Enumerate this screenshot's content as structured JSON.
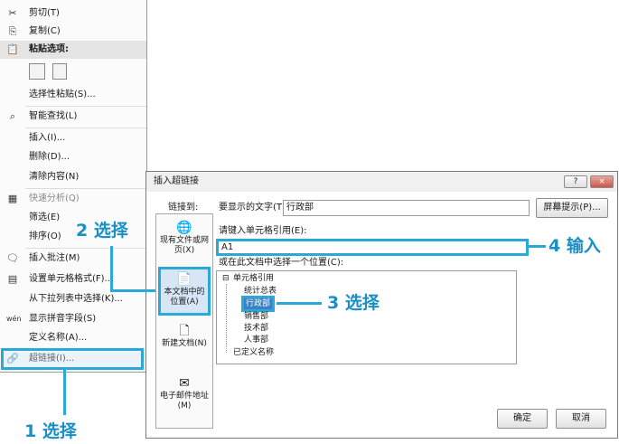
{
  "context_menu": {
    "cut": "剪切(T)",
    "copy": "复制(C)",
    "paste_options": "粘贴选项:",
    "paste_special": "选择性粘贴(S)...",
    "smart_lookup": "智能查找(L)",
    "insert": "插入(I)...",
    "delete": "删除(D)...",
    "clear_contents": "清除内容(N)",
    "quick_analysis": "快速分析(Q)",
    "filter": "筛选(E)",
    "sort": "排序(O)",
    "insert_comment": "插入批注(M)",
    "format_cells": "设置单元格格式(F)...",
    "pick_from_list": "从下拉列表中选择(K)...",
    "phonetic": "显示拼音字段(S)",
    "define_name": "定义名称(A)...",
    "hyperlink": "超链接(I)..."
  },
  "dialog": {
    "title": "插入超链接",
    "help_btn": "?",
    "close_btn": "×",
    "link_to_label": "链接到:",
    "display_text_label": "要显示的文字(T):",
    "display_text_value": "行政部",
    "screen_tip_btn": "屏幕提示(P)...",
    "cell_ref_label": "请键入单元格引用(E):",
    "cell_ref_value": "A1",
    "select_place_label": "或在此文档中选择一个位置(C):",
    "nav": {
      "existing_file": "现有文件或网页(X)",
      "this_document": "本文档中的位置(A)",
      "new_document": "新建文档(N)",
      "email": "电子邮件地址(M)"
    },
    "tree": {
      "cell_refs": "单元格引用",
      "items": [
        "统计总表",
        "行政部",
        "销售部",
        "技术部",
        "人事部"
      ],
      "defined_names": "已定义名称"
    },
    "ok_btn": "确定",
    "cancel_btn": "取消"
  },
  "callouts": {
    "step1": "1 选择",
    "step2": "2 选择",
    "step3": "3 选择",
    "step4": "4 输入"
  }
}
